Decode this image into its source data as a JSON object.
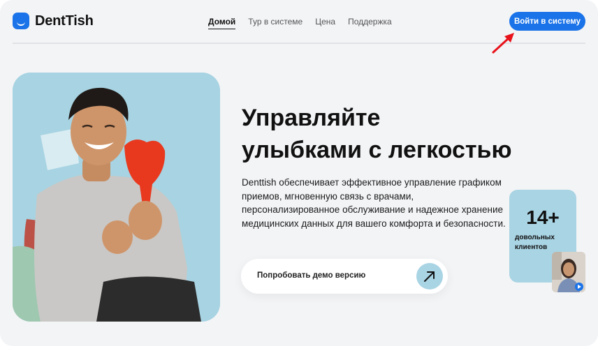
{
  "header": {
    "logo_text": "DentTish",
    "nav": [
      {
        "label": "Домой",
        "active": true
      },
      {
        "label": "Тур в системе",
        "active": false
      },
      {
        "label": "Цена",
        "active": false
      },
      {
        "label": "Поддержка",
        "active": false
      }
    ],
    "login_label": "Войти в систему"
  },
  "hero": {
    "headline_line1": "Управляйте",
    "headline_line2": "улыбками с легкостью",
    "description": "Denttish обеспечивает эффективное управление графиком приемов, мгновенную связь с врачами, персонализированное обслуживание и надежное хранение медицинских данных для вашего комфорта и безопасности.",
    "demo_label": "Попробовать демо версию"
  },
  "stats": {
    "number": "14+",
    "label": "довольных клиентов"
  },
  "colors": {
    "accent": "#1a73e8",
    "light_blue": "#a9d4e4",
    "annotation_red": "#e8121b"
  }
}
